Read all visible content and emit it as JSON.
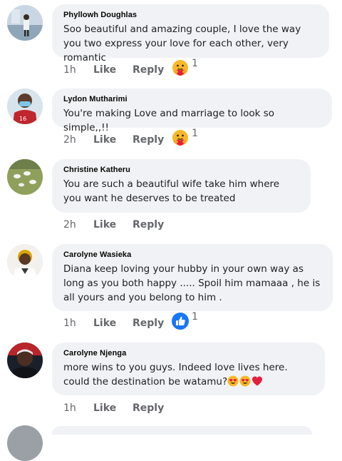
{
  "comments": [
    {
      "author": "Phyllowh Doughlas",
      "text": "Soo beautiful and amazing couple, I love the way you two express your love for each other, very romantic",
      "time": "1h",
      "like_label": "Like",
      "reply_label": "Reply",
      "reaction": "care-emoji-icon",
      "reaction_count": "1"
    },
    {
      "author": "Lydon Mutharimi",
      "text": "You're making Love and marriage to look so simple,,!!",
      "time": "2h",
      "like_label": "Like",
      "reply_label": "Reply",
      "reaction": "care-emoji-icon",
      "reaction_count": "1"
    },
    {
      "author": "Christine Katheru",
      "text": "You are such a beautiful wife take him where you want he deserves to be treated",
      "time": "2h",
      "like_label": "Like",
      "reply_label": "Reply"
    },
    {
      "author": "Carolyne Wasieka",
      "text": "Diana keep loving your hubby in your own way as long as you both happy ..... Spoil him mamaaa , he is all yours and you belong to him .",
      "time": "1h",
      "like_label": "Like",
      "reply_label": "Reply",
      "reaction": "like-thumb-icon",
      "reaction_count": "1"
    },
    {
      "author": "Carolyne Njenga",
      "text": "more wins to you guys. Indeed love lives here. could the destination be watamu?",
      "time": "1h",
      "like_label": "Like",
      "reply_label": "Reply",
      "trailing_emojis": [
        "heart-eyes-emoji-icon",
        "heart-eyes-emoji-icon",
        "red-heart-icon"
      ]
    }
  ],
  "colors": {
    "bubble": "#f0f2f5",
    "meta_text": "#65676b",
    "like_blue": "#1877f2",
    "emoji_yellow": "#f7b928",
    "heart_red": "#e41e3f"
  }
}
